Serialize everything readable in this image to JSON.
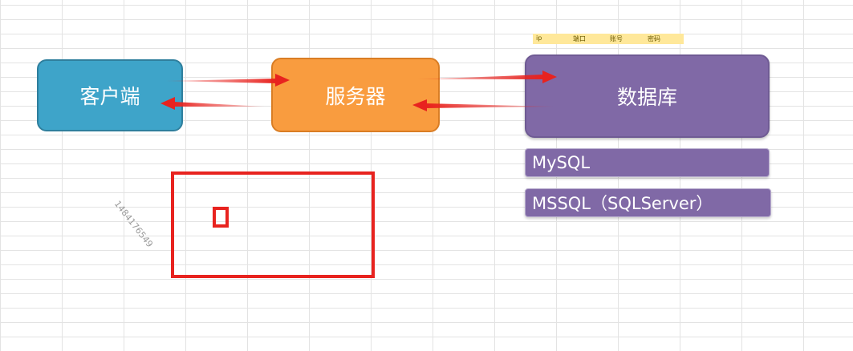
{
  "header_strip": {
    "labels": [
      "ip",
      "端口",
      "账号",
      "密码"
    ]
  },
  "nodes": {
    "client": "客户端",
    "server": "服务器",
    "database": "数据库"
  },
  "database_types": [
    "MySQL",
    "MSSQL（SQLServer）"
  ],
  "watermark": "1484176549",
  "colors": {
    "client": "#3ea4c9",
    "server": "#f99c3f",
    "database": "#8069a6",
    "arrow": "#e8231f",
    "highlight": "#ffe89a"
  }
}
